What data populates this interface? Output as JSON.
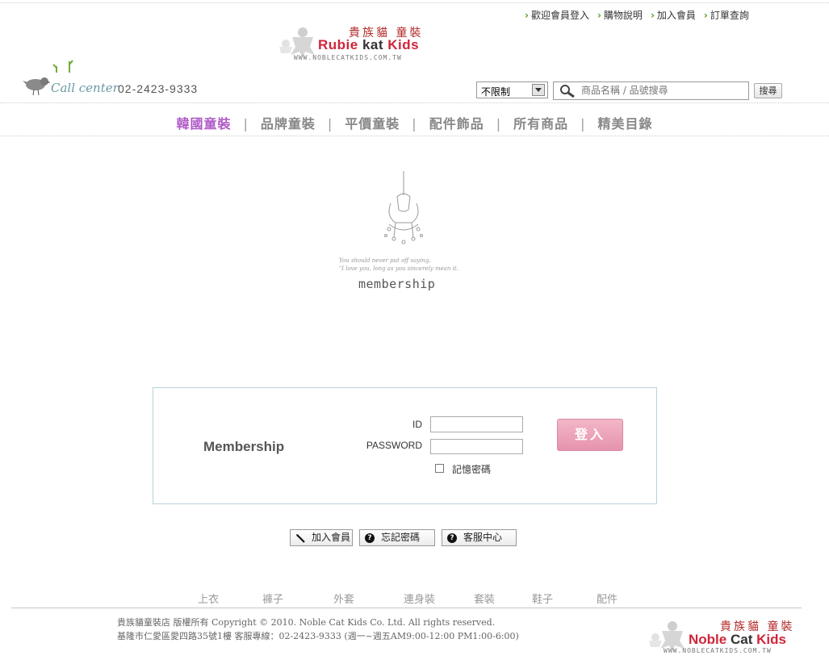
{
  "top_links": [
    {
      "label": "歡迎會員登入"
    },
    {
      "label": "購物說明"
    },
    {
      "label": "加入會員"
    },
    {
      "label": "訂單查詢"
    }
  ],
  "logo": {
    "zh": "貴族貓 童裝",
    "en_first": "Rubie",
    "en_second": " kat ",
    "en_third": "Kids",
    "url": "WWW.NOBLECATKIDS.COM.TW"
  },
  "call_center": {
    "label": "Call center",
    "phone": "02-2423-9333"
  },
  "search": {
    "scope_value": "不限制",
    "placeholder": "商品名稱 / 品號搜尋",
    "button": "搜尋"
  },
  "nav": [
    {
      "label": "韓國童裝",
      "active": true
    },
    {
      "label": "品牌童裝"
    },
    {
      "label": "平價童裝"
    },
    {
      "label": "配件飾品"
    },
    {
      "label": "所有商品"
    },
    {
      "label": "精美目錄"
    }
  ],
  "hero": {
    "script_line1": "You should never put off saying,",
    "script_line2": "\"I love you, long as you sincerely mean it.",
    "title": "membership"
  },
  "login": {
    "title": "Membership",
    "id_label": "ID",
    "password_label": "PASSWORD",
    "id_value": "",
    "password_value": "",
    "remember_label": "記憶密碼",
    "submit": "登入"
  },
  "actions": {
    "join": "加入會員",
    "forgot": "忘記密碼",
    "service": "客服中心"
  },
  "footer_categories": [
    "上衣",
    "褲子",
    "外套",
    "連身裝",
    "套裝",
    "鞋子",
    "配件"
  ],
  "footer": {
    "copyright": "貴族貓童裝店   版權所有 Copyright © 2010. Noble Cat Kids Co. Ltd. All rights reserved.",
    "address": "基隆市仁愛區愛四路35號1樓   客服專線：02-2423-9333 (週一~週五AM9:00-12:00    PM1:00-6:00)",
    "logo_zh": "貴族貓 童裝",
    "logo_en_first": "Noble",
    "logo_en_second": " Cat ",
    "logo_en_third": "Kids",
    "logo_url": "WWW.NOBLECATKIDS.COM.TW"
  },
  "colors": {
    "accent_purple": "#b05bc7",
    "login_pink": "#e693ad",
    "border_blue": "#b9d2dc"
  }
}
